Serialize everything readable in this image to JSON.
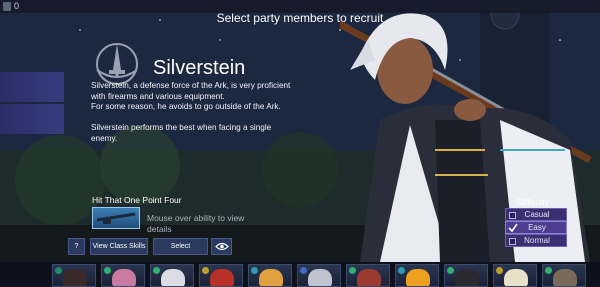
{
  "header": {
    "top_count": "0",
    "title": "Select party members to recruit"
  },
  "character": {
    "name": "Silverstein",
    "description": [
      "Silverstein, a defense force of the Ark, is very proficient",
      "with firearms and various equipment.",
      "For some reason, he avoids to go outside of the Ark.",
      "",
      "Silverstein performs the best when facing a single",
      "enemy."
    ]
  },
  "ability": {
    "title": "Hit That One Point Four",
    "hint": "Mouse over ability to view details"
  },
  "buttons": {
    "help": "?",
    "view_class_skills": "View Class Skills",
    "select": "Select",
    "eye_icon": "eye-icon"
  },
  "difficulty": {
    "title": "Difficulty",
    "options": [
      {
        "label": "Casual",
        "checked": false
      },
      {
        "label": "Easy",
        "checked": true
      },
      {
        "label": "Normal",
        "checked": false
      }
    ]
  },
  "roster": [
    {
      "hair": "#3a2a2a",
      "badge": "#1f8a6a"
    },
    {
      "hair": "#c87aa0",
      "badge": "#2fb070"
    },
    {
      "hair": "#dcdce4",
      "badge": "#2fb070"
    },
    {
      "hair": "#b83028",
      "badge": "#c0a030"
    },
    {
      "hair": "#e0a040",
      "badge": "#2f9ab0"
    },
    {
      "hair": "#c0c4d0",
      "badge": "#4a6ac8"
    },
    {
      "hair": "#9a3a30",
      "badge": "#2fb070"
    },
    {
      "hair": "#f0a020",
      "badge": "#2f9ab0"
    },
    {
      "hair": "#2a2a30",
      "badge": "#2fb070"
    },
    {
      "hair": "#e8e0c8",
      "badge": "#c0a030"
    },
    {
      "hair": "#7a6a5a",
      "badge": "#2fb070"
    }
  ],
  "colors": {
    "accent": "#3b2f72",
    "button": "#2a3a5e"
  }
}
